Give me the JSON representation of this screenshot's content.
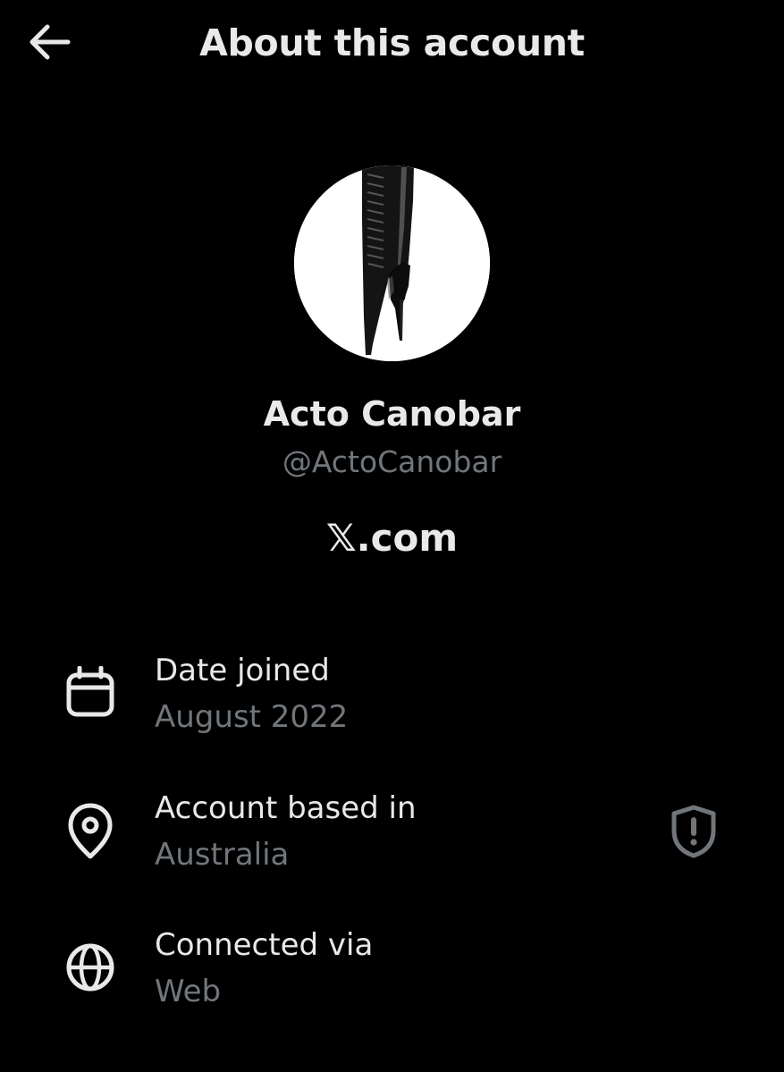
{
  "header": {
    "back_icon": "arrow-left-icon",
    "title": "About this account"
  },
  "profile": {
    "avatar_subject": "black patent lace-up ballet boot",
    "display_name": "Acto Canobar",
    "handle": "@ActoCanobar",
    "platform_x_glyph": "𝕏",
    "platform_suffix": ".com"
  },
  "details": [
    {
      "icon": "calendar-icon",
      "label": "Date joined",
      "value": "August 2022"
    },
    {
      "icon": "location-pin-icon",
      "label": "Account based in",
      "value": "Australia",
      "action_icon": "shield-alert-icon"
    },
    {
      "icon": "globe-icon",
      "label": "Connected via",
      "value": "Web"
    }
  ],
  "colors": {
    "background": "#000000",
    "primary_text": "#e7e9ea",
    "secondary_text": "#71767b"
  }
}
